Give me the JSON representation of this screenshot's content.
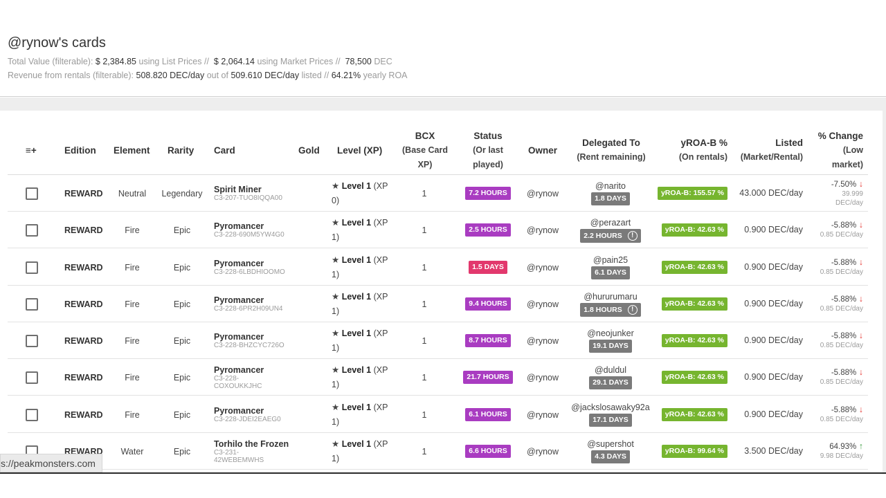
{
  "header": {
    "title": "@rynow's cards",
    "total_label": "Total Value (filterable):",
    "total_list_value": "$ 2,384.85",
    "using_list": "using List Prices //",
    "total_market_value": "$ 2,064.14",
    "using_market": "using Market Prices //",
    "dec_value": "78,500",
    "dec_unit": "DEC",
    "revenue_label": "Revenue from rentals (filterable):",
    "revenue_value": "508.820 DEC/day",
    "out_of": "out of",
    "listed_value": "509.610 DEC/day",
    "listed_suffix": "listed //",
    "roa_value": "64.21%",
    "roa_suffix": "yearly ROA"
  },
  "table": {
    "columns": {
      "menu_icon": "≡+",
      "edition": "Edition",
      "element": "Element",
      "rarity": "Rarity",
      "card": "Card",
      "gold": "Gold",
      "level": "Level (XP)",
      "bcx": "BCX",
      "bcx_sub": "(Base Card XP)",
      "status": "Status",
      "status_sub": "(Or last played)",
      "owner": "Owner",
      "delegated": "Delegated To",
      "delegated_sub": "(Rent remaining)",
      "yroa": "yROA-B %",
      "yroa_sub": "(On rentals)",
      "listed": "Listed",
      "listed_sub": "(Market/Rental)",
      "change": "% Change",
      "change_sub": "(Low market)"
    },
    "rows": [
      {
        "edition": "REWARD",
        "element": "Neutral",
        "rarity": "Legendary",
        "card": "Spirit Miner",
        "card_id": "C3-207-TUO8IQQA00",
        "level": "Level 1",
        "xp": "(XP 0)",
        "bcx": "1",
        "status": "7.2 HOURS",
        "owner": "@rynow",
        "delegated": "@narito",
        "rent": "1.8 DAYS",
        "yroa": "yROA-B: 155.57 %",
        "listed": "43.000 DEC/day",
        "change": "-7.50%",
        "change_sub": "39.999 DEC/day"
      },
      {
        "edition": "REWARD",
        "element": "Fire",
        "rarity": "Epic",
        "card": "Pyromancer",
        "card_id": "C3-228-690M5YW4G0",
        "level": "Level 1",
        "xp": "(XP 1)",
        "bcx": "1",
        "status": "2.5 HOURS",
        "owner": "@rynow",
        "delegated": "@perazart",
        "rent": "2.2 HOURS",
        "yroa": "yROA-B: 42.63 %",
        "listed": "0.900 DEC/day",
        "change": "-5.88%",
        "change_sub": "0.85 DEC/day"
      },
      {
        "edition": "REWARD",
        "element": "Fire",
        "rarity": "Epic",
        "card": "Pyromancer",
        "card_id": "C3-228-6LBDHIOOMO",
        "level": "Level 1",
        "xp": "(XP 1)",
        "bcx": "1",
        "status": "1.5 DAYS",
        "owner": "@rynow",
        "delegated": "@pain25",
        "rent": "6.1 DAYS",
        "yroa": "yROA-B: 42.63 %",
        "listed": "0.900 DEC/day",
        "change": "-5.88%",
        "change_sub": "0.85 DEC/day"
      },
      {
        "edition": "REWARD",
        "element": "Fire",
        "rarity": "Epic",
        "card": "Pyromancer",
        "card_id": "C3-228-6PR2H09UN4",
        "level": "Level 1",
        "xp": "(XP 1)",
        "bcx": "1",
        "status": "9.4 HOURS",
        "owner": "@rynow",
        "delegated": "@hururumaru",
        "rent": "1.8 HOURS",
        "yroa": "yROA-B: 42.63 %",
        "listed": "0.900 DEC/day",
        "change": "-5.88%",
        "change_sub": "0.85 DEC/day"
      },
      {
        "edition": "REWARD",
        "element": "Fire",
        "rarity": "Epic",
        "card": "Pyromancer",
        "card_id": "C3-228-BHZCYC726O",
        "level": "Level 1",
        "xp": "(XP 1)",
        "bcx": "1",
        "status": "8.7 HOURS",
        "owner": "@rynow",
        "delegated": "@neojunker",
        "rent": "19.1 DAYS",
        "yroa": "yROA-B: 42.63 %",
        "listed": "0.900 DEC/day",
        "change": "-5.88%",
        "change_sub": "0.85 DEC/day"
      },
      {
        "edition": "REWARD",
        "element": "Fire",
        "rarity": "Epic",
        "card": "Pyromancer",
        "card_id": "C3-228-COXOUKKJHC",
        "level": "Level 1",
        "xp": "(XP 1)",
        "bcx": "1",
        "status": "21.7 HOURS",
        "owner": "@rynow",
        "delegated": "@duldul",
        "rent": "29.1 DAYS",
        "yroa": "yROA-B: 42.63 %",
        "listed": "0.900 DEC/day",
        "change": "-5.88%",
        "change_sub": "0.85 DEC/day"
      },
      {
        "edition": "REWARD",
        "element": "Fire",
        "rarity": "Epic",
        "card": "Pyromancer",
        "card_id": "C3-228-JDEI2EAEG0",
        "level": "Level 1",
        "xp": "(XP 1)",
        "bcx": "1",
        "status": "6.1 HOURS",
        "owner": "@rynow",
        "delegated": "@jackslosawaky92a",
        "rent": "17.1 DAYS",
        "yroa": "yROA-B: 42.63 %",
        "listed": "0.900 DEC/day",
        "change": "-5.88%",
        "change_sub": "0.85 DEC/day"
      },
      {
        "edition": "REWARD",
        "element": "Water",
        "rarity": "Epic",
        "card": "Torhilo the Frozen",
        "card_id": "C3-231-42WEBEMWHS",
        "level": "Level 1",
        "xp": "(XP 1)",
        "bcx": "1",
        "status": "6.6 HOURS",
        "owner": "@rynow",
        "delegated": "@supershot",
        "rent": "4.3 DAYS",
        "yroa": "yROA-B: 99.64 %",
        "listed": "3.500 DEC/day",
        "change": "64.93%",
        "change_sub": "9.98 DEC/day"
      }
    ]
  },
  "statusbar": {
    "url": "s://peakmonsters.com"
  },
  "icons": {
    "star": "star-icon",
    "menu": "column-menu-icon",
    "warning": "warning-icon",
    "arrow_down": "arrow-down-icon",
    "arrow_up": "arrow-up-icon"
  },
  "colors": {
    "status_purple": "#a93cc1",
    "status_pink": "#e2386d",
    "rent_gray": "#7a7a7a",
    "yroa_green": "#76b52f",
    "down_red": "#e53935",
    "up_green": "#43a047"
  }
}
